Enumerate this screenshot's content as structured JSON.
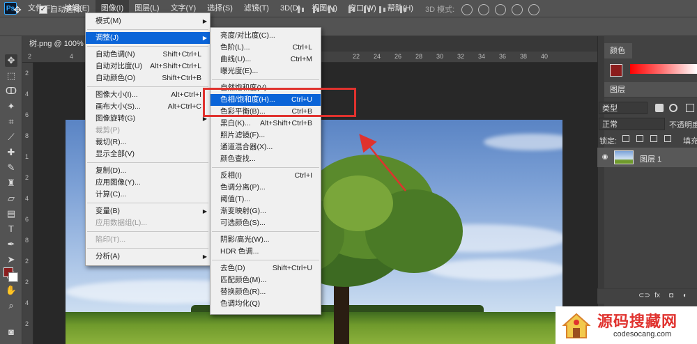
{
  "app": {
    "logo_text": "Ps"
  },
  "menubar": {
    "items": [
      "文件(F)",
      "编辑(E)",
      "图像(I)",
      "图层(L)",
      "文字(Y)",
      "选择(S)",
      "滤镜(T)",
      "3D(D)",
      "视图(V)",
      "窗口(W)",
      "帮助(H)"
    ],
    "active_index": 2
  },
  "options_bar": {
    "auto_select_label": "自动选择:",
    "auto_select_checked": true,
    "mode_3d_label": "3D 模式:"
  },
  "document": {
    "tab_title": "树.png @ 100% (图"
  },
  "ruler": {
    "h_numbers": [
      "2",
      "4",
      "6",
      "22",
      "24",
      "26",
      "28",
      "30",
      "32",
      "34",
      "36",
      "38",
      "40"
    ],
    "v_numbers": [
      "2",
      "4",
      "6",
      "8",
      "1",
      "2",
      "4",
      "6",
      "8",
      "2",
      "2",
      "4",
      "2"
    ]
  },
  "image_menu": {
    "items": [
      {
        "label": "模式(M)",
        "submenu": true
      },
      {
        "separator": true
      },
      {
        "label": "调整(J)",
        "submenu": true,
        "highlighted": true
      },
      {
        "separator": true
      },
      {
        "label": "自动色调(N)",
        "shortcut": "Shift+Ctrl+L"
      },
      {
        "label": "自动对比度(U)",
        "shortcut": "Alt+Shift+Ctrl+L"
      },
      {
        "label": "自动颜色(O)",
        "shortcut": "Shift+Ctrl+B"
      },
      {
        "separator": true
      },
      {
        "label": "图像大小(I)...",
        "shortcut": "Alt+Ctrl+I"
      },
      {
        "label": "画布大小(S)...",
        "shortcut": "Alt+Ctrl+C"
      },
      {
        "label": "图像旋转(G)",
        "submenu": true
      },
      {
        "label": "裁剪(P)",
        "disabled": true
      },
      {
        "label": "裁切(R)..."
      },
      {
        "label": "显示全部(V)"
      },
      {
        "separator": true
      },
      {
        "label": "复制(D)..."
      },
      {
        "label": "应用图像(Y)..."
      },
      {
        "label": "计算(C)..."
      },
      {
        "separator": true
      },
      {
        "label": "变量(B)",
        "submenu": true
      },
      {
        "label": "应用数据组(L)...",
        "disabled": true
      },
      {
        "separator": true
      },
      {
        "label": "陷印(T)...",
        "disabled": true
      },
      {
        "separator": true
      },
      {
        "label": "分析(A)",
        "submenu": true
      }
    ]
  },
  "adjust_menu": {
    "items": [
      {
        "label": "亮度/对比度(C)..."
      },
      {
        "label": "色阶(L)...",
        "shortcut": "Ctrl+L"
      },
      {
        "label": "曲线(U)...",
        "shortcut": "Ctrl+M"
      },
      {
        "label": "曝光度(E)..."
      },
      {
        "separator": true
      },
      {
        "label": "自然饱和度(V)..."
      },
      {
        "label": "色相/饱和度(H)...",
        "shortcut": "Ctrl+U",
        "highlighted": true
      },
      {
        "label": "色彩平衡(B)...",
        "shortcut": "Ctrl+B"
      },
      {
        "label": "黑白(K)...",
        "shortcut": "Alt+Shift+Ctrl+B"
      },
      {
        "label": "照片滤镜(F)..."
      },
      {
        "label": "通道混合器(X)..."
      },
      {
        "label": "颜色查找..."
      },
      {
        "separator": true
      },
      {
        "label": "反相(I)",
        "shortcut": "Ctrl+I"
      },
      {
        "label": "色调分离(P)..."
      },
      {
        "label": "阈值(T)..."
      },
      {
        "label": "渐变映射(G)..."
      },
      {
        "label": "可选颜色(S)..."
      },
      {
        "separator": true
      },
      {
        "label": "阴影/高光(W)..."
      },
      {
        "label": "HDR 色调..."
      },
      {
        "separator": true
      },
      {
        "label": "去色(D)",
        "shortcut": "Shift+Ctrl+U"
      },
      {
        "label": "匹配颜色(M)..."
      },
      {
        "label": "替换颜色(R)..."
      },
      {
        "label": "色调均化(Q)"
      }
    ]
  },
  "panels": {
    "color_tab": "颜色",
    "layers_tab": "图层",
    "layer_filter": "类型",
    "blend_mode": "正常",
    "opacity_label": "不透明度",
    "lock_label": "锁定:",
    "fill_label": "填充",
    "layers": [
      {
        "name": "图层 1",
        "visible": true
      }
    ],
    "bottom_icons": [
      "link-icon",
      "fx-icon",
      "mask-icon",
      "adjustment-icon"
    ]
  },
  "colors": {
    "foreground": "#8b1d1d",
    "background": "#ffffff",
    "highlight": "#0a64d8",
    "annotation_red": "#e0322e"
  },
  "watermark": {
    "title": "源码搜藏网",
    "url": "codesocang.com"
  }
}
